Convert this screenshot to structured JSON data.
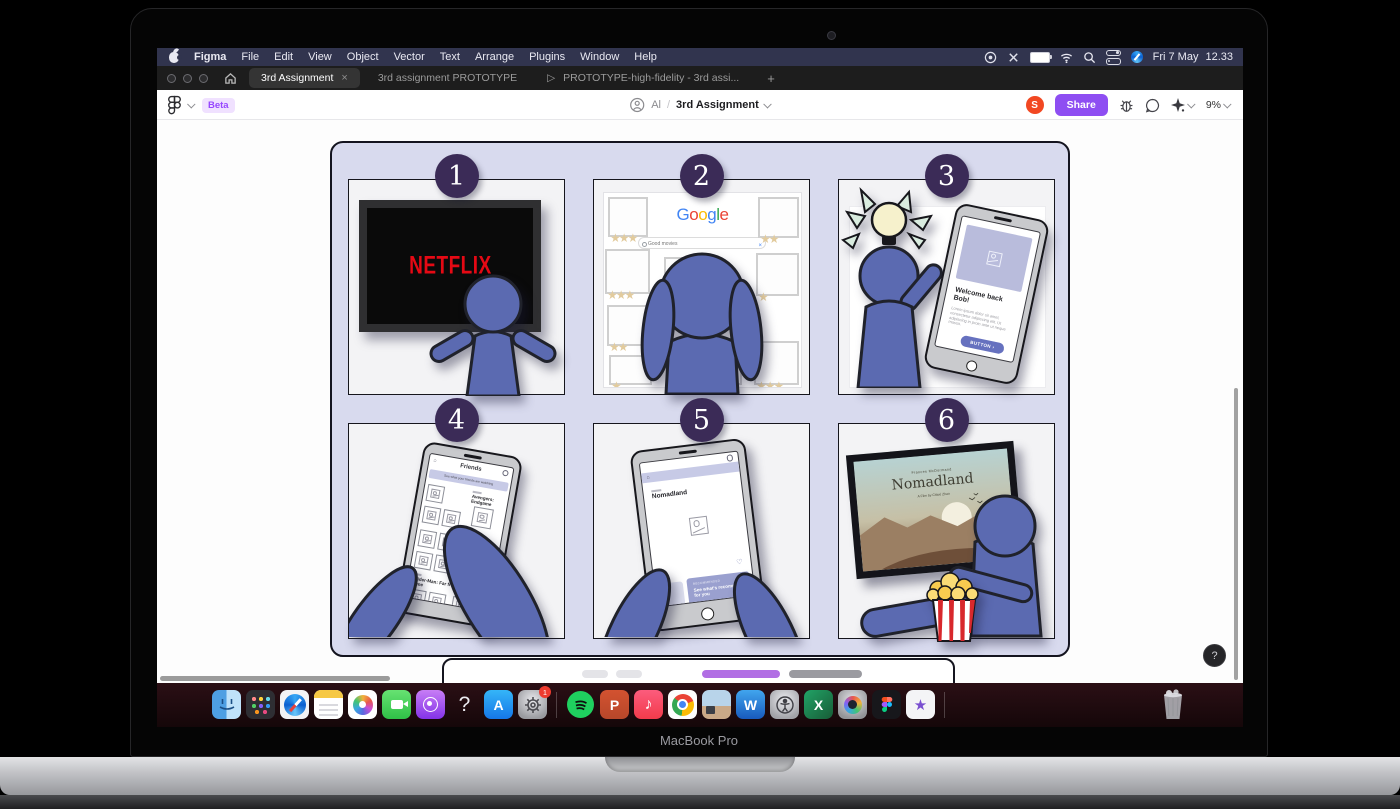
{
  "menubar": {
    "items": [
      "Figma",
      "File",
      "Edit",
      "View",
      "Object",
      "Vector",
      "Text",
      "Arrange",
      "Plugins",
      "Window",
      "Help"
    ],
    "date": "Fri 7 May",
    "time": "12.33"
  },
  "tabbar": {
    "tabs": [
      {
        "label": "3rd Assignment",
        "close": "×"
      },
      {
        "label": "3rd assignment PROTOTYPE"
      },
      {
        "label": "PROTOTYPE-high-fidelity - 3rd assi..."
      }
    ],
    "play_glyph": "▷",
    "new_tab": "+"
  },
  "toolbar": {
    "beta": "Beta",
    "breadcrumb_team": "Al",
    "breadcrumb_sep": "/",
    "file_name": "3rd Assignment",
    "avatar_initial": "S",
    "share_label": "Share",
    "zoom_level": "9%"
  },
  "storyboard": {
    "panels": {
      "p1": {
        "number": "1",
        "tv_text": "NETFLIX"
      },
      "p2": {
        "number": "2",
        "google_letters": [
          "G",
          "o",
          "o",
          "g",
          "l",
          "e"
        ],
        "search_text": "Good movies",
        "stars": {
          "s3": "★★★",
          "s2": "★★",
          "s1": "★"
        }
      },
      "p3": {
        "number": "3",
        "welcome_title": "Welcome back Bob!",
        "welcome_body": "Lorem ipsum dolor sit amet, consectetur adipiscing elit. Ut adipiscing in proin ante ut neque massa.",
        "button_label": "BUTTON ›"
      },
      "p4": {
        "number": "4",
        "header": "Friends",
        "banner": "See what your friends are watching",
        "movie1": "Avengers: Endgame",
        "movie2": "Spider-Man: Far from home"
      },
      "p5": {
        "number": "5",
        "title": "Nomadland",
        "rec_label": "RECOMMENDED",
        "rec_text": "See what's recommended for you"
      },
      "p6": {
        "number": "6",
        "poster_actor": "Frances McDormand",
        "poster_title": "Nomadland",
        "poster_tagline": "A Film by Chloé Zhao"
      }
    }
  },
  "window": {
    "help_label": "?"
  },
  "dock": {
    "items": [
      "finder",
      "launchpad",
      "safari",
      "notes",
      "photos",
      "facetime",
      "podcasts",
      "question-placeholder",
      "app-store",
      "settings",
      "spotify",
      "powerpoint",
      "music",
      "chrome",
      "photo-thumbnail",
      "word",
      "accessibility",
      "excel",
      "photo-booth",
      "figma",
      "imovie",
      "trash"
    ],
    "glyphs": {
      "appstore": "A",
      "powerpoint": "P",
      "word": "W",
      "excel": "X",
      "music": "♪",
      "imovie": "★",
      "question": "?"
    },
    "badge_settings": "1"
  },
  "laptop": {
    "label": "MacBook Pro"
  },
  "colors": {
    "share_button": "#8e4ef2",
    "beta_badge_text": "#9747ff",
    "netflix_red": "#e50914",
    "person_blue": "#5b6ab1",
    "storyboard_bg": "#d8daee",
    "badge_purple": "#3b2b57",
    "avatar_orange": "#f24822"
  }
}
